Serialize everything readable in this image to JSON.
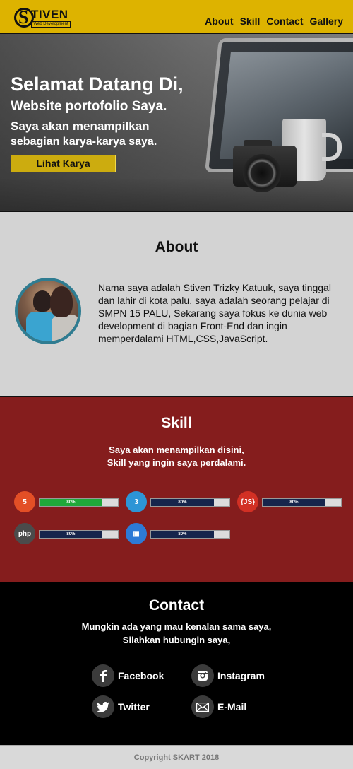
{
  "nav": {
    "logo_letter": "S",
    "logo_text": "TIVEN",
    "logo_subtitle": "Web Development",
    "menu": [
      "About",
      "Skill",
      "Contact",
      "Gallery"
    ]
  },
  "hero": {
    "title": "Selamat Datang Di,",
    "subtitle": "Website portofolio Saya.",
    "line1": "Saya akan menampilkan",
    "line2": "sebagian karya-karya saya.",
    "button": "Lihat Karya"
  },
  "about": {
    "title": "About",
    "text": "Nama saya adalah Stiven Trizky Katuuk, saya tinggal dan lahir di kota palu, saya adalah seorang pelajar di SMPN 15 PALU, Sekarang saya fokus ke dunia web development di bagian Front-End dan ingin memperdalami HTML,CSS,JavaScript."
  },
  "skill": {
    "title": "Skill",
    "line1": "Saya akan menampilkan disini,",
    "line2": "Skill yang ingin saya perdalami.",
    "items": [
      {
        "icon": "html5-icon",
        "icon_text": "5",
        "icon_color": "#e34f26",
        "fill_color": "#1fa83a",
        "label": "80%",
        "level": 0.8
      },
      {
        "icon": "css3-icon",
        "icon_text": "3",
        "icon_color": "#2d95d6",
        "fill_color": "#16254c",
        "label": "80%",
        "level": 0.8
      },
      {
        "icon": "javascript-icon",
        "icon_text": "{JS}",
        "icon_color": "#d23024",
        "fill_color": "#16254c",
        "label": "80%",
        "level": 0.8
      },
      {
        "icon": "php-icon",
        "icon_text": "php",
        "icon_color": "#4b4b4b",
        "fill_color": "#16254c",
        "label": "80%",
        "level": 0.8
      },
      {
        "icon": "web-design-icon",
        "icon_text": "▣",
        "icon_color": "#2d7ad6",
        "fill_color": "#16254c",
        "label": "80%",
        "level": 0.8
      }
    ]
  },
  "contact": {
    "title": "Contact",
    "line1": "Mungkin ada yang mau kenalan sama saya,",
    "line2": "Silahkan hubungin saya,",
    "links": [
      {
        "label": "Facebook",
        "icon": "facebook-icon"
      },
      {
        "label": "Instagram",
        "icon": "instagram-icon"
      },
      {
        "label": "Twitter",
        "icon": "twitter-icon"
      },
      {
        "label": "E-Mail",
        "icon": "email-icon"
      }
    ]
  },
  "footer": {
    "copyright": "Copyright SKART 2018"
  }
}
